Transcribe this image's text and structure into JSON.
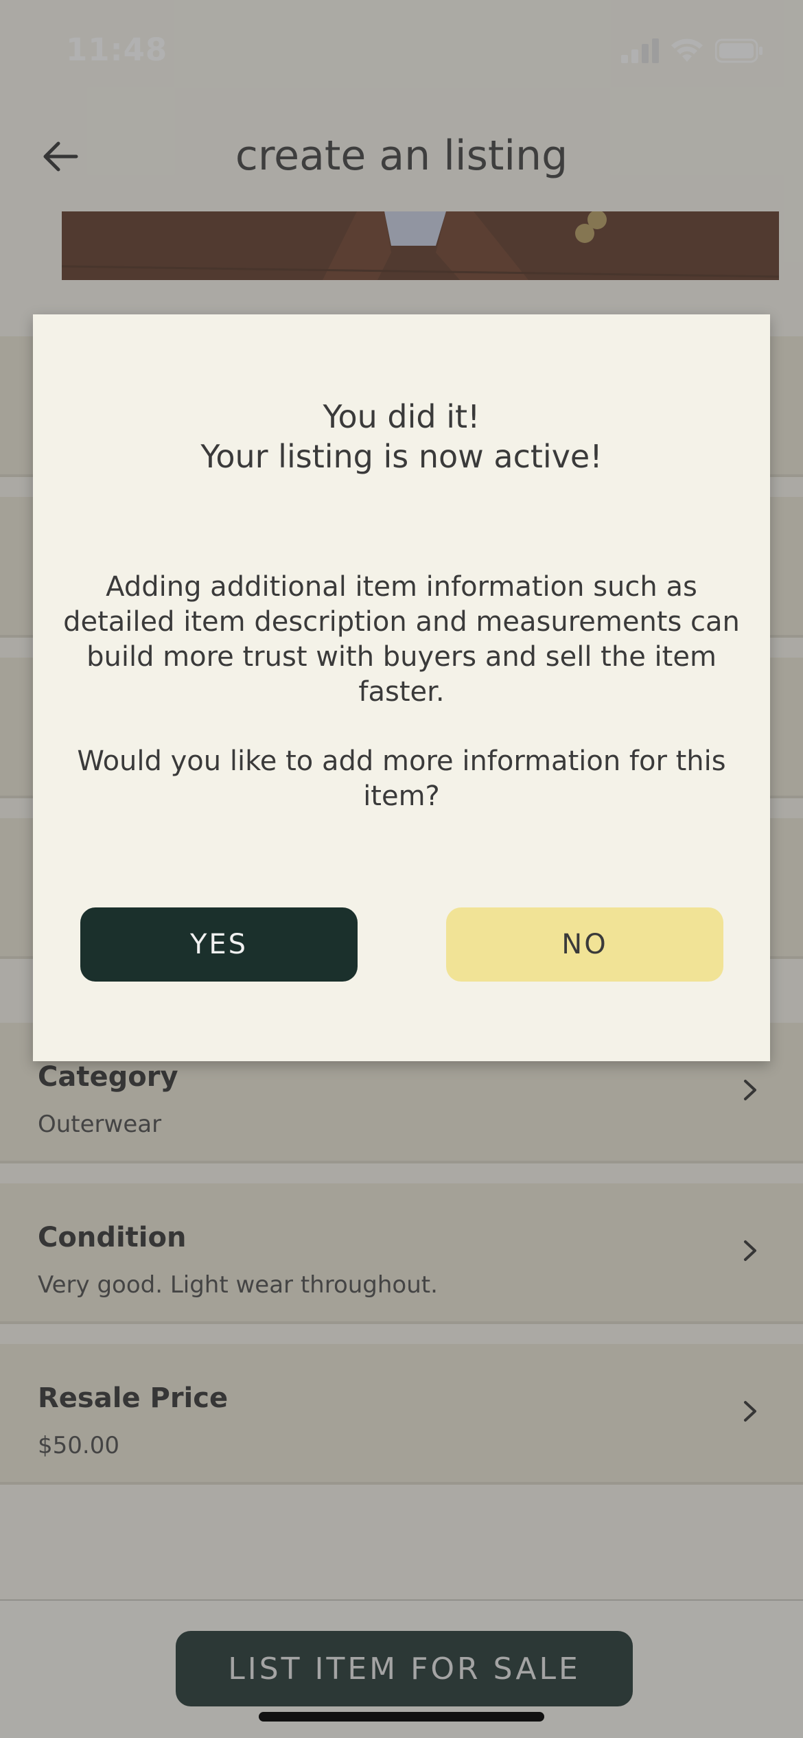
{
  "status_bar": {
    "time": "11:48"
  },
  "header": {
    "title": "create an listing"
  },
  "fields": [
    {
      "label": "Category",
      "value": "Outerwear"
    },
    {
      "label": "Condition",
      "value": "Very good. Light wear throughout."
    },
    {
      "label": "Resale Price",
      "value": "$50.00"
    }
  ],
  "footer": {
    "list_button_label": "LIST ITEM FOR SALE"
  },
  "modal": {
    "title_line1": "You did it!",
    "title_line2": "Your listing is now active!",
    "body": "Adding additional item information such as detailed item description and measurements can build more trust with buyers and sell the item faster.",
    "question": "Would you like to add more information for this item?",
    "yes_label": "YES",
    "no_label": "NO"
  },
  "colors": {
    "accent_dark": "#1b302c",
    "accent_yellow": "#f1e396",
    "background": "#f4f2e8"
  }
}
